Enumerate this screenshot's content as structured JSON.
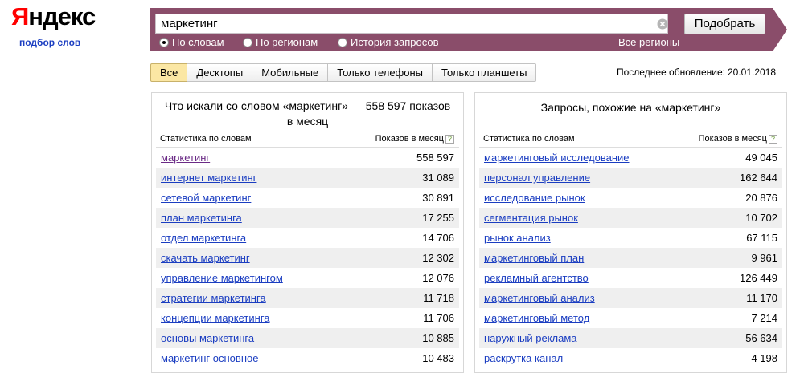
{
  "logo": {
    "text_first": "Я",
    "text_rest": "ндекс",
    "subtitle": "подбор слов"
  },
  "search": {
    "value": "маркетинг",
    "button": "Подобрать"
  },
  "modes": [
    {
      "label": "По словам",
      "selected": true
    },
    {
      "label": "По регионам",
      "selected": false
    },
    {
      "label": "История запросов",
      "selected": false
    }
  ],
  "regions_link": "Все регионы",
  "tabs": [
    "Все",
    "Десктопы",
    "Мобильные",
    "Только телефоны",
    "Только планшеты"
  ],
  "updated": {
    "label": "Последнее обновление:",
    "date": "20.01.2018"
  },
  "left": {
    "title": "Что искали со словом «маркетинг» — 558 597 показов в месяц",
    "col_words": "Статистика по словам",
    "col_shows": "Показов в месяц",
    "help": "?",
    "rows": [
      {
        "word": "маркетинг",
        "count": "558 597"
      },
      {
        "word": "интернет маркетинг",
        "count": "31 089"
      },
      {
        "word": "сетевой маркетинг",
        "count": "30 891"
      },
      {
        "word": "план маркетинга",
        "count": "17 255"
      },
      {
        "word": "отдел маркетинга",
        "count": "14 706"
      },
      {
        "word": "скачать маркетинг",
        "count": "12 302"
      },
      {
        "word": "управление маркетингом",
        "count": "12 076"
      },
      {
        "word": "стратегии маркетинга",
        "count": "11 718"
      },
      {
        "word": "концепции маркетинга",
        "count": "11 706"
      },
      {
        "word": "основы маркетинга",
        "count": "10 885"
      },
      {
        "word": "маркетинг основное",
        "count": "10 483"
      }
    ]
  },
  "right": {
    "title": "Запросы, похожие на «маркетинг»",
    "col_words": "Статистика по словам",
    "col_shows": "Показов в месяц",
    "help": "?",
    "rows": [
      {
        "word": "маркетинговый исследование",
        "count": "49 045"
      },
      {
        "word": "персонал управление",
        "count": "162 644"
      },
      {
        "word": "исследование рынок",
        "count": "20 876"
      },
      {
        "word": "сегментация рынок",
        "count": "10 702"
      },
      {
        "word": "рынок анализ",
        "count": "67 115"
      },
      {
        "word": "маркетинговый план",
        "count": "9 961"
      },
      {
        "word": "рекламный агентство",
        "count": "126 449"
      },
      {
        "word": "маркетинговый анализ",
        "count": "11 170"
      },
      {
        "word": "маркетинговый метод",
        "count": "7 214"
      },
      {
        "word": "наружный реклама",
        "count": "56 634"
      },
      {
        "word": "раскрутка канал",
        "count": "4 198"
      }
    ]
  },
  "colors": {
    "bar": "#8a4d6a",
    "link": "#1a3dc1",
    "visited": "#6b2b86",
    "active_tab": "#fbe7a4"
  }
}
